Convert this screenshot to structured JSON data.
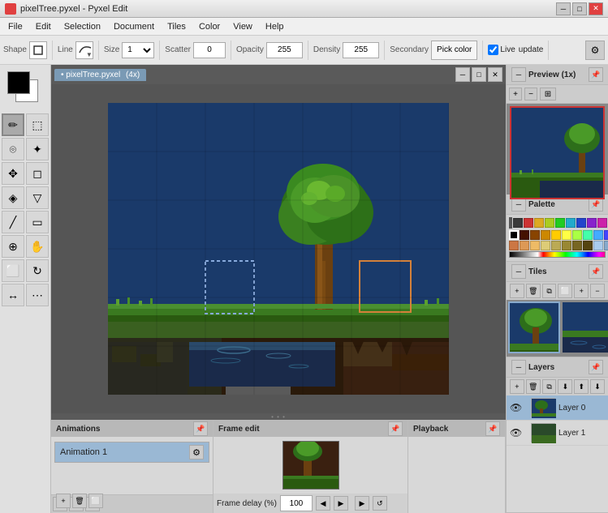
{
  "window": {
    "title": "pixelTree.pyxel - Pyxel Edit",
    "icon": "🎨"
  },
  "menubar": {
    "items": [
      "File",
      "Edit",
      "Selection",
      "Document",
      "Tiles",
      "Color",
      "View",
      "Help"
    ]
  },
  "toolbar": {
    "shape_label": "Shape",
    "line_label": "Line",
    "size_label": "Size",
    "scatter_label": "Scatter",
    "opacity_label": "Opacity",
    "density_label": "Density",
    "secondary_label": "Secondary",
    "size_value": "1",
    "scatter_value": "0",
    "opacity_value": "255",
    "density_value": "255",
    "color_pick_label": "Pick color",
    "live_update_label": "Live",
    "update_label": "update"
  },
  "canvas": {
    "tab_label": "• pixelTree.pyxel",
    "zoom_label": "(4x)"
  },
  "preview": {
    "title": "Preview (1x)",
    "zoom_in": "+",
    "zoom_out": "-"
  },
  "palette": {
    "title": "Palette",
    "colors": [
      "#000000",
      "#ffffff",
      "#ff0000",
      "#00ff00",
      "#0000ff",
      "#ffff00",
      "#ff00ff",
      "#00ffff",
      "#800000",
      "#008000",
      "#000080",
      "#808000",
      "#800080",
      "#008080",
      "#c0c0c0",
      "#808080",
      "#ff8080",
      "#80ff80",
      "#8080ff",
      "#ffff80",
      "#ff80ff",
      "#80ffff",
      "#ff4000",
      "#ff8000",
      "#40ff00",
      "#00ff80",
      "#0040ff",
      "#4000ff",
      "#ff0080",
      "#8000ff",
      "#804000",
      "#408000",
      "#004080",
      "#800040",
      "#400080",
      "#008040",
      "#d4813a",
      "#5a8a30",
      "#2d6e2d",
      "#6b4010",
      "#1a3a6a",
      "#3a6a20",
      "#e8c870",
      "#c8a050",
      "#a87030",
      "#885010",
      "#663010",
      "#441800",
      "#88aacc",
      "#668899",
      "#446677",
      "#224455",
      "#112233",
      "#001122"
    ]
  },
  "tiles": {
    "title": "Tiles",
    "add_btn": "+",
    "delete_btn": "🗑",
    "copy_btn": "⧉",
    "select_btn": "⬜",
    "zoom_in": "+",
    "zoom_out": "-"
  },
  "layers": {
    "title": "Layers",
    "items": [
      {
        "name": "Layer 0",
        "visible": true,
        "selected": true
      },
      {
        "name": "Layer 1",
        "visible": true,
        "selected": false
      }
    ]
  },
  "animations": {
    "title": "Animations",
    "items": [
      {
        "name": "Animation 1",
        "selected": true
      }
    ],
    "add_btn": "+",
    "delete_btn": "🗑"
  },
  "frame_edit": {
    "title": "Frame edit",
    "delay_label": "Frame delay (%)",
    "delay_value": "100",
    "prev_btn": "◀",
    "next_btn": "▶",
    "play_btn": "▶",
    "loop_btn": "↺"
  },
  "playback": {
    "title": "Playback"
  },
  "tools": [
    {
      "id": "pencil",
      "icon": "✏",
      "tooltip": "Pencil"
    },
    {
      "id": "select-rect",
      "icon": "⬚",
      "tooltip": "Rectangular Select"
    },
    {
      "id": "move",
      "icon": "✥",
      "tooltip": "Move"
    },
    {
      "id": "lasso",
      "icon": "⌾",
      "tooltip": "Lasso"
    },
    {
      "id": "wand",
      "icon": "✦",
      "tooltip": "Magic Wand"
    },
    {
      "id": "eraser",
      "icon": "◻",
      "tooltip": "Eraser"
    },
    {
      "id": "fill",
      "icon": "▼",
      "tooltip": "Fill"
    },
    {
      "id": "dropper",
      "icon": "◈",
      "tooltip": "Color Picker"
    },
    {
      "id": "line",
      "icon": "╱",
      "tooltip": "Line"
    },
    {
      "id": "rect",
      "icon": "▭",
      "tooltip": "Rectangle"
    },
    {
      "id": "stamp",
      "icon": "⬜",
      "tooltip": "Stamp"
    },
    {
      "id": "zoom",
      "icon": "⊕",
      "tooltip": "Zoom"
    },
    {
      "id": "hand",
      "icon": "✋",
      "tooltip": "Hand"
    },
    {
      "id": "rotate",
      "icon": "↻",
      "tooltip": "Rotate"
    }
  ],
  "colors": {
    "accent": "#9ab8d4",
    "panel_bg": "#d8d8d8",
    "toolbar_bg": "#e8e8e8",
    "canvas_bg": "#4a4a4a",
    "selection_color": "#5588bb"
  }
}
